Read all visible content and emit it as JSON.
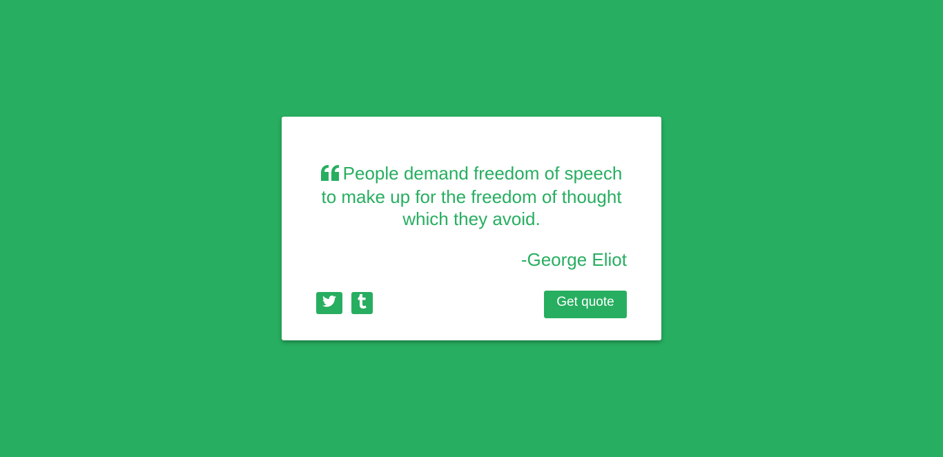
{
  "quote": {
    "text": "People demand freedom of speech to make up for the freedom of thought which they avoid.",
    "author": "-George Eliot"
  },
  "buttons": {
    "new_quote_label": "Get quote"
  },
  "icons": {
    "quote": "quote-left-icon",
    "twitter": "twitter-icon",
    "tumblr": "tumblr-icon"
  },
  "colors": {
    "accent": "#27ae60",
    "card_background": "#ffffff"
  }
}
